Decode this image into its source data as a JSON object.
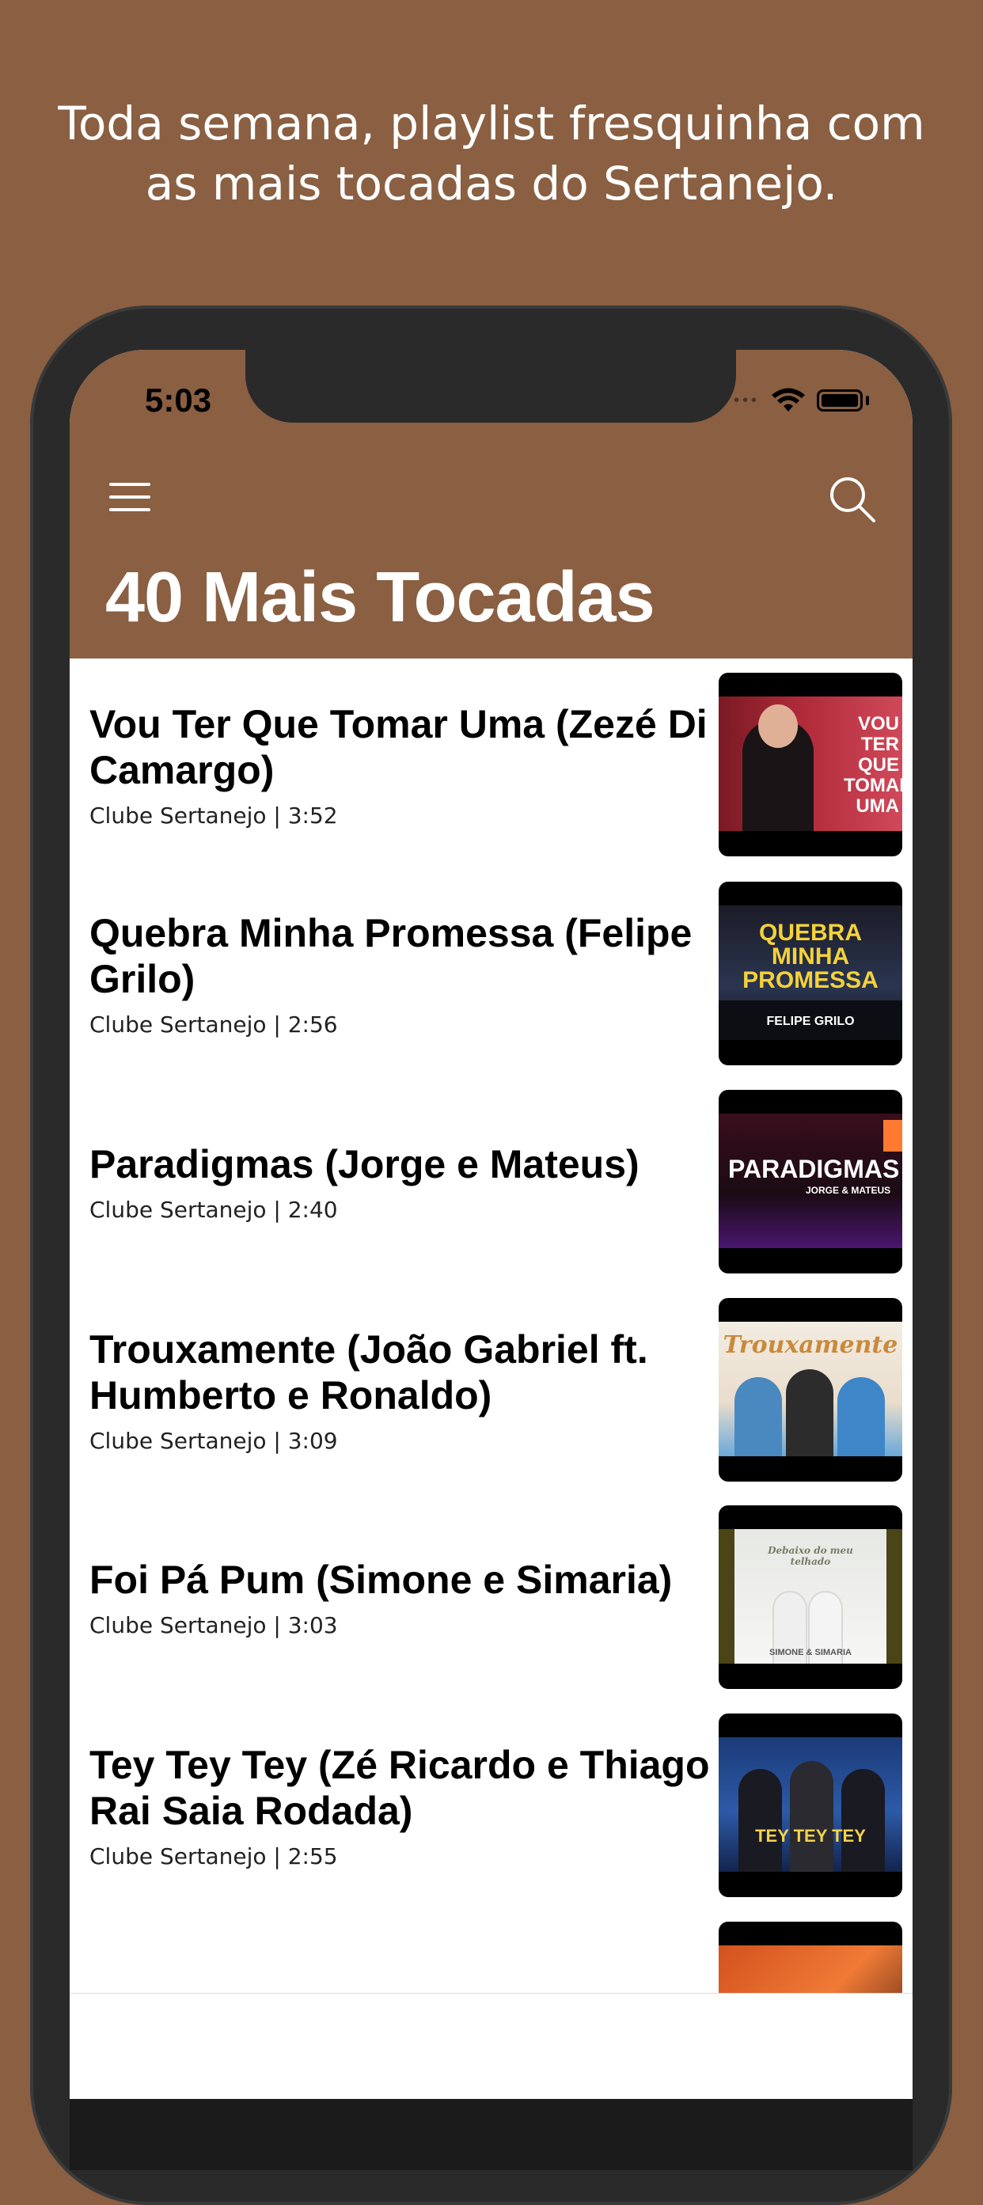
{
  "promo_text": "Toda semana, playlist fresquinha com as mais tocadas do Sertanejo.",
  "status_bar": {
    "time": "5:03",
    "dots": "•••"
  },
  "header": {
    "title": "40 Mais Tocadas",
    "background": "#8a5f42"
  },
  "songs": [
    {
      "title": "Vou Ter Que Tomar Uma (Zezé Di Camargo)",
      "meta": "Clube Sertanejo | 3:52",
      "thumb_text": "VOU TER QUE TOMAR UMA"
    },
    {
      "title": "Quebra Minha Promessa (Felipe Grilo)",
      "meta": "Clube Sertanejo | 2:56",
      "thumb_text": "QUEBRA MINHA PROMESSA",
      "thumb_sub": "FELIPE GRILO"
    },
    {
      "title": "Paradigmas (Jorge e Mateus)",
      "meta": "Clube Sertanejo | 2:40",
      "thumb_text": "PARADIGMAS",
      "thumb_sub": "JORGE & MATEUS"
    },
    {
      "title": "Trouxamente (João Gabriel ft. Humberto e Ronaldo)",
      "meta": "Clube Sertanejo | 3:09",
      "thumb_text": "Trouxamente"
    },
    {
      "title": "Foi Pá Pum (Simone e Simaria)",
      "meta": "Clube Sertanejo | 3:03",
      "thumb_text": "Debaixo do meu telhado",
      "thumb_sub": "SIMONE & SIMARIA"
    },
    {
      "title": "Tey Tey Tey (Zé Ricardo e Thiago + Rai Saia Rodada)",
      "meta": "Clube Sertanejo | 2:55",
      "thumb_text": "TEY TEY TEY"
    }
  ]
}
